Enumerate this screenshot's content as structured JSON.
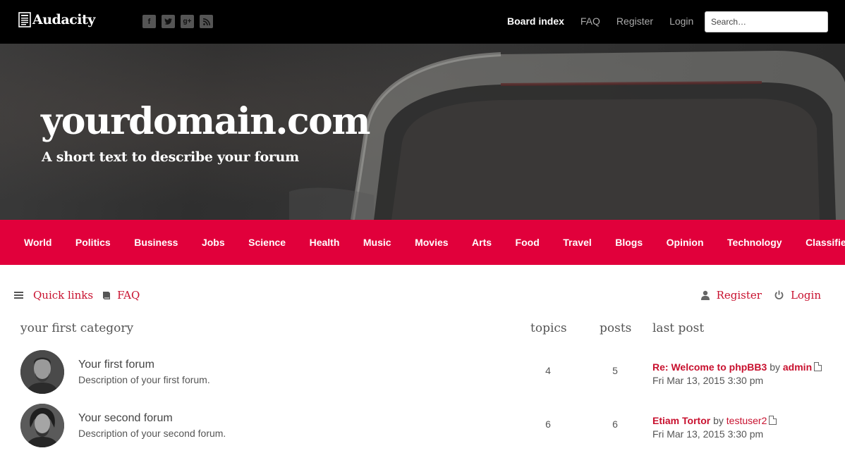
{
  "brand": {
    "name": "Audacity",
    "icon": "newspaper-icon"
  },
  "socials": [
    {
      "label": "f",
      "icon": "facebook-icon"
    },
    {
      "label": "t",
      "icon": "twitter-icon"
    },
    {
      "label": "g+",
      "icon": "google-plus-icon"
    },
    {
      "label": "rss",
      "icon": "rss-icon"
    }
  ],
  "topnav": {
    "board_index": "Board index",
    "faq": "FAQ",
    "register": "Register",
    "login": "Login"
  },
  "search": {
    "placeholder": "Search…"
  },
  "hero": {
    "title": "yourdomain.com",
    "subtitle": "A short text to describe your forum"
  },
  "categories": [
    "World",
    "Politics",
    "Business",
    "Jobs",
    "Science",
    "Health",
    "Music",
    "Movies",
    "Arts",
    "Food",
    "Travel",
    "Blogs",
    "Opinion",
    "Technology",
    "Classifieds"
  ],
  "quick": {
    "quick_links": "Quick links",
    "faq": "FAQ",
    "register": "Register",
    "login": "Login"
  },
  "table": {
    "category": "your first category",
    "col_topics": "topics",
    "col_posts": "posts",
    "col_last_post": "last post",
    "forums": [
      {
        "title": "Your first forum",
        "description": "Description of your first forum.",
        "topics": "4",
        "posts": "5",
        "last_post_title": "Re: Welcome to phpBB3",
        "last_post_by": "by",
        "last_post_user": "admin",
        "last_post_date": "Fri Mar 13, 2015 3:30 pm"
      },
      {
        "title": "Your second forum",
        "description": "Description of your second forum.",
        "topics": "6",
        "posts": "6",
        "last_post_title": "Etiam Tortor",
        "last_post_by": "by",
        "last_post_user": "testuser2",
        "last_post_date": "Fri Mar 13, 2015 3:30 pm"
      }
    ]
  },
  "colors": {
    "accent": "#e1003b",
    "link": "#c8102e",
    "topbar": "#000000"
  }
}
